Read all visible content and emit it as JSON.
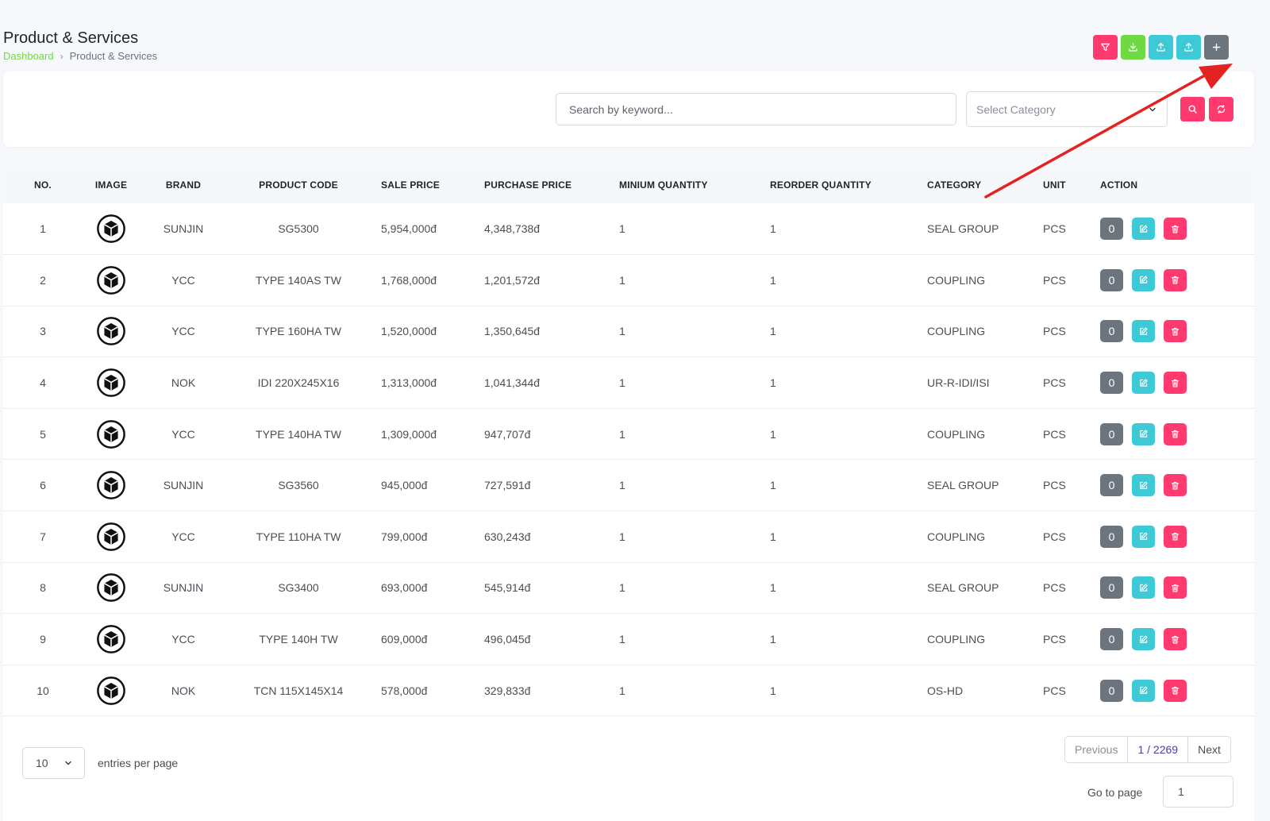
{
  "page": {
    "title": "Product & Services",
    "breadcrumb": {
      "home": "Dashboard",
      "separator": "›",
      "current": "Product & Services"
    }
  },
  "toolbar": {
    "buttons": [
      {
        "name": "filter-button",
        "icon": "filter-icon",
        "color": "#ff3a6e"
      },
      {
        "name": "download-button",
        "icon": "download-icon",
        "color": "#6fd943"
      },
      {
        "name": "upload-button",
        "icon": "upload-icon",
        "color": "#3ec9d6"
      },
      {
        "name": "import-button",
        "icon": "upload-icon",
        "color": "#3ec9d6"
      },
      {
        "name": "add-button",
        "icon": "plus-icon",
        "color": "#6c757d"
      }
    ]
  },
  "filters": {
    "search_placeholder": "Search by keyword...",
    "category_placeholder": "Select Category"
  },
  "table": {
    "columns": [
      "NO.",
      "IMAGE",
      "BRAND",
      "PRODUCT CODE",
      "SALE PRICE",
      "PURCHASE PRICE",
      "MINIUM QUANTITY",
      "REORDER QUANTITY",
      "CATEGORY",
      "UNIT",
      "ACTION"
    ],
    "rows": [
      {
        "no": "1",
        "brand": "SUNJIN",
        "code": "SG5300",
        "sale": "5,954,000đ",
        "purchase": "4,348,738đ",
        "min_qty": "1",
        "reorder_qty": "1",
        "category": "SEAL GROUP",
        "unit": "PCS",
        "qty_badge": "0"
      },
      {
        "no": "2",
        "brand": "YCC",
        "code": "TYPE 140AS TW",
        "sale": "1,768,000đ",
        "purchase": "1,201,572đ",
        "min_qty": "1",
        "reorder_qty": "1",
        "category": "COUPLING",
        "unit": "PCS",
        "qty_badge": "0"
      },
      {
        "no": "3",
        "brand": "YCC",
        "code": "TYPE 160HA TW",
        "sale": "1,520,000đ",
        "purchase": "1,350,645đ",
        "min_qty": "1",
        "reorder_qty": "1",
        "category": "COUPLING",
        "unit": "PCS",
        "qty_badge": "0"
      },
      {
        "no": "4",
        "brand": "NOK",
        "code": "IDI 220X245X16",
        "sale": "1,313,000đ",
        "purchase": "1,041,344đ",
        "min_qty": "1",
        "reorder_qty": "1",
        "category": "UR-R-IDI/ISI",
        "unit": "PCS",
        "qty_badge": "0"
      },
      {
        "no": "5",
        "brand": "YCC",
        "code": "TYPE 140HA TW",
        "sale": "1,309,000đ",
        "purchase": "947,707đ",
        "min_qty": "1",
        "reorder_qty": "1",
        "category": "COUPLING",
        "unit": "PCS",
        "qty_badge": "0"
      },
      {
        "no": "6",
        "brand": "SUNJIN",
        "code": "SG3560",
        "sale": "945,000đ",
        "purchase": "727,591đ",
        "min_qty": "1",
        "reorder_qty": "1",
        "category": "SEAL GROUP",
        "unit": "PCS",
        "qty_badge": "0"
      },
      {
        "no": "7",
        "brand": "YCC",
        "code": "TYPE 110HA TW",
        "sale": "799,000đ",
        "purchase": "630,243đ",
        "min_qty": "1",
        "reorder_qty": "1",
        "category": "COUPLING",
        "unit": "PCS",
        "qty_badge": "0"
      },
      {
        "no": "8",
        "brand": "SUNJIN",
        "code": "SG3400",
        "sale": "693,000đ",
        "purchase": "545,914đ",
        "min_qty": "1",
        "reorder_qty": "1",
        "category": "SEAL GROUP",
        "unit": "PCS",
        "qty_badge": "0"
      },
      {
        "no": "9",
        "brand": "YCC",
        "code": "TYPE 140H TW",
        "sale": "609,000đ",
        "purchase": "496,045đ",
        "min_qty": "1",
        "reorder_qty": "1",
        "category": "COUPLING",
        "unit": "PCS",
        "qty_badge": "0"
      },
      {
        "no": "10",
        "brand": "NOK",
        "code": "TCN 115X145X14",
        "sale": "578,000đ",
        "purchase": "329,833đ",
        "min_qty": "1",
        "reorder_qty": "1",
        "category": "OS-HD",
        "unit": "PCS",
        "qty_badge": "0"
      }
    ]
  },
  "pagination": {
    "per_page_value": "10",
    "per_page_label": "entries per page",
    "previous": "Previous",
    "page_info": "1 / 2269",
    "next": "Next",
    "goto_label": "Go to page",
    "goto_value": "1"
  },
  "colors": {
    "accent_green": "#6fd943",
    "danger": "#ff3a6e",
    "info": "#3ec9d6",
    "secondary": "#6c757d",
    "annotation_arrow": "#e32222"
  }
}
